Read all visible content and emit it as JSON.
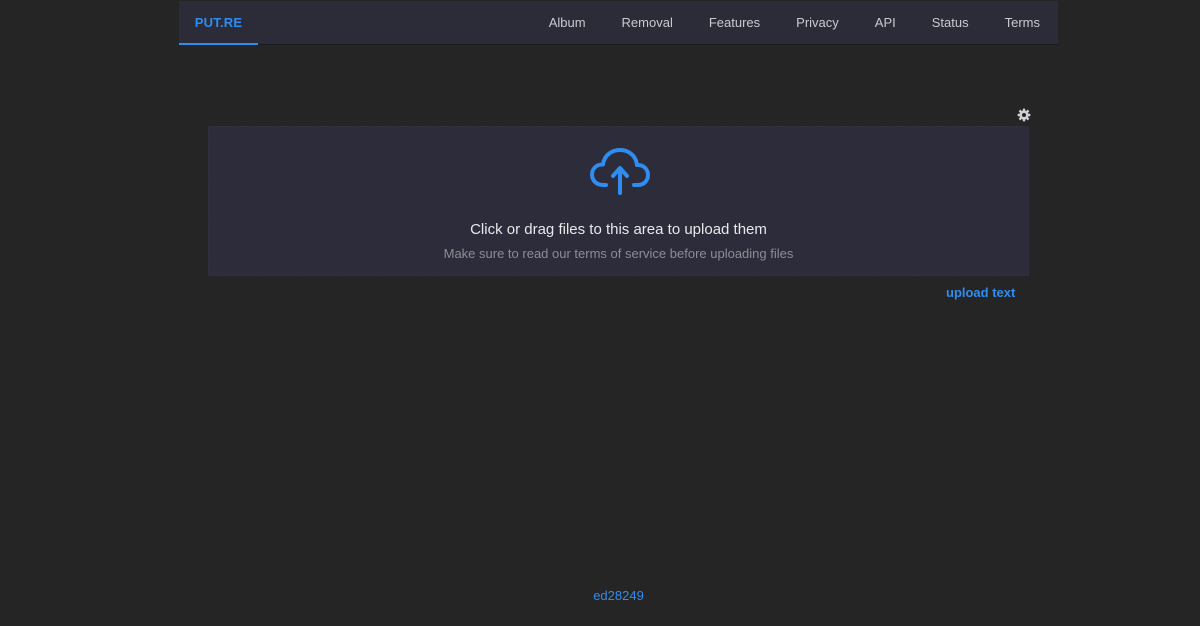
{
  "brand": "PUT.RE",
  "nav": {
    "items": [
      "Album",
      "Removal",
      "Features",
      "Privacy",
      "API",
      "Status",
      "Terms"
    ]
  },
  "icons": {
    "settings": "gear-icon",
    "upload": "cloud-upload-icon"
  },
  "upload": {
    "title": "Click or drag files to this area to upload them",
    "hint": "Make sure to read our terms of service before uploading files"
  },
  "upload_text_link": "upload text",
  "footer": {
    "version": "ed28249"
  },
  "colors": {
    "accent": "#2f8cf0",
    "background": "#252525",
    "panel": "#2c2c3a"
  }
}
